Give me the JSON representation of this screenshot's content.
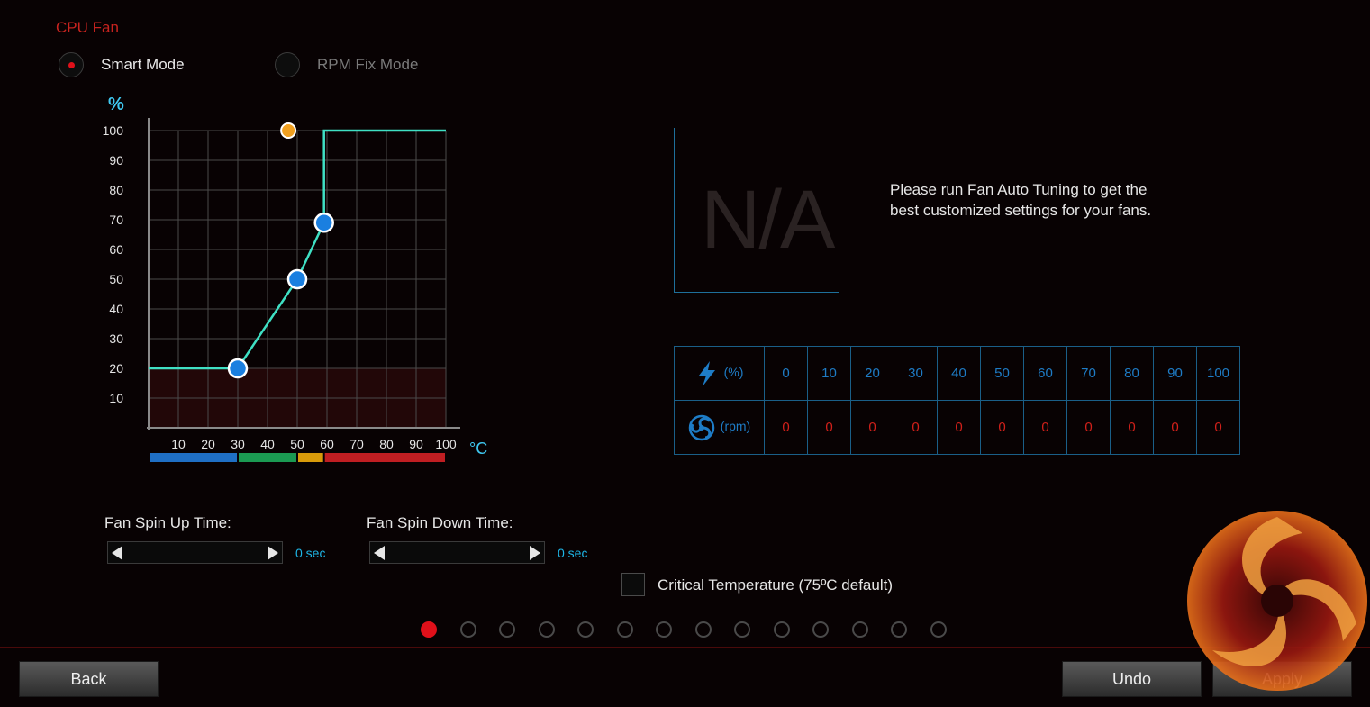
{
  "title": "CPU Fan",
  "modes": {
    "smart": "Smart Mode",
    "rpm_fix": "RPM Fix Mode",
    "selected": "smart"
  },
  "graph": {
    "y_unit": "%",
    "x_unit": "°C",
    "y_ticks": [
      "100",
      "90",
      "80",
      "70",
      "60",
      "50",
      "40",
      "30",
      "20",
      "10"
    ],
    "x_ticks": [
      "10",
      "20",
      "30",
      "40",
      "50",
      "60",
      "70",
      "80",
      "90",
      "100"
    ],
    "curve_points": [
      [
        30,
        20
      ],
      [
        50,
        50
      ],
      [
        59,
        69
      ]
    ],
    "curve_line": [
      [
        0,
        20
      ],
      [
        30,
        20
      ],
      [
        50,
        50
      ],
      [
        59,
        69
      ],
      [
        59,
        100
      ],
      [
        100,
        100
      ]
    ],
    "orange_point": [
      47,
      100
    ],
    "temp_bands": [
      {
        "from": 0,
        "to": 30,
        "color": "#1f6fc4"
      },
      {
        "from": 30,
        "to": 50,
        "color": "#1b9a52"
      },
      {
        "from": 50,
        "to": 59,
        "color": "#d89a0a"
      },
      {
        "from": 59,
        "to": 100,
        "color": "#c01e22"
      }
    ],
    "colors": {
      "line": "#3fe0c4",
      "point": "#1a7fe0",
      "orange": "#f0a020",
      "shade": "#220708",
      "grid": "#4a4a4a"
    }
  },
  "na": {
    "text": "N/A",
    "message": "Please run Fan Auto Tuning to get the best customized settings for your fans."
  },
  "table": {
    "pct_unit": "(%)",
    "rpm_unit": "(rpm)",
    "pct_values": [
      "0",
      "10",
      "20",
      "30",
      "40",
      "50",
      "60",
      "70",
      "80",
      "90",
      "100"
    ],
    "rpm_values": [
      "0",
      "0",
      "0",
      "0",
      "0",
      "0",
      "0",
      "0",
      "0",
      "0",
      "0"
    ],
    "pct_icon": "lightning-icon",
    "rpm_icon": "fan-icon"
  },
  "spin_up": {
    "label": "Fan Spin Up Time:",
    "value": "0 sec"
  },
  "spin_down": {
    "label": "Fan Spin Down Time:",
    "value": "0 sec"
  },
  "critical": {
    "label": "Critical Temperature (75ºC default)",
    "checked": false
  },
  "pages": {
    "count": 14,
    "active": 0
  },
  "buttons": {
    "back": "Back",
    "undo": "Undo",
    "apply": "Apply"
  }
}
